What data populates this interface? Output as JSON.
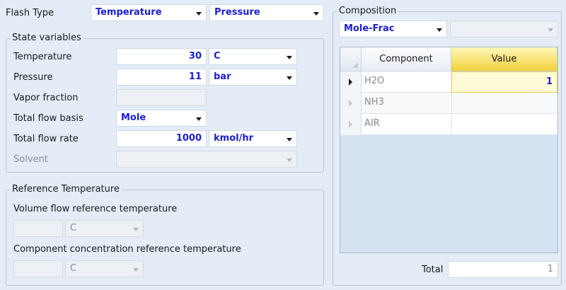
{
  "flash": {
    "label": "Flash Type",
    "spec1": "Temperature",
    "spec2": "Pressure"
  },
  "state": {
    "legend": "State variables",
    "temperature": {
      "label": "Temperature",
      "value": "30",
      "unit": "C"
    },
    "pressure": {
      "label": "Pressure",
      "value": "11",
      "unit": "bar"
    },
    "vapor_fraction": {
      "label": "Vapor fraction",
      "value": ""
    },
    "flow_basis": {
      "label": "Total flow basis",
      "value": "Mole"
    },
    "flow_rate": {
      "label": "Total flow rate",
      "value": "1000",
      "unit": "kmol/hr"
    },
    "solvent": {
      "label": "Solvent",
      "value": ""
    }
  },
  "reference": {
    "legend": "Reference Temperature",
    "volume_label": "Volume flow reference temperature",
    "volume_value": "",
    "volume_unit": "C",
    "conc_label": "Component concentration reference temperature",
    "conc_value": "",
    "conc_unit": "C"
  },
  "composition": {
    "legend": "Composition",
    "basis": "Mole-Frac",
    "basis2": "",
    "columns": [
      "Component",
      "Value"
    ],
    "rows": [
      {
        "component": "H2O",
        "value": "1"
      },
      {
        "component": "NH3",
        "value": ""
      },
      {
        "component": "AIR",
        "value": ""
      }
    ],
    "total_label": "Total",
    "total_value": "1"
  }
}
